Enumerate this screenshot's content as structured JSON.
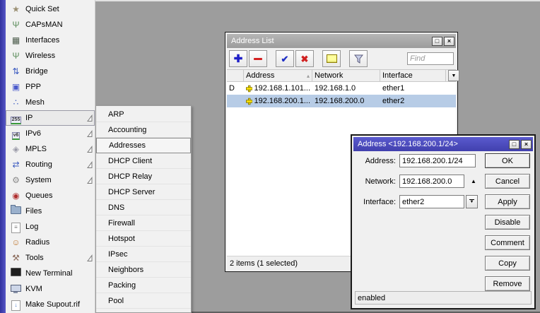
{
  "colors": {
    "accent_titlebar": "#4747bd",
    "inactive_titlebar": "#a8a8a8",
    "selected_row": "#b7cce6",
    "canvas": "#9d9d9d"
  },
  "icons": {
    "wand": "★",
    "antenna": "Ψ",
    "interfaces": "▦",
    "bridge": "⇅",
    "ppp": "▣",
    "mesh": "∴",
    "ip_chip": "255",
    "ipv6_chip": "v6",
    "mpls": "◈",
    "routing": "⇄",
    "system": "⚙",
    "queues": "◉",
    "log": "≡",
    "radius": "☺",
    "tools": "⚒",
    "supout": "↓",
    "plus": "✚",
    "check": "✔",
    "cross": "✖",
    "maximize": "□",
    "close": "×",
    "dropdown": "▼",
    "up_arrow": "▲",
    "sort_asc": "▴"
  },
  "sidebar": {
    "items": [
      {
        "label": "Quick Set"
      },
      {
        "label": "CAPsMAN"
      },
      {
        "label": "Interfaces"
      },
      {
        "label": "Wireless"
      },
      {
        "label": "Bridge"
      },
      {
        "label": "PPP"
      },
      {
        "label": "Mesh"
      },
      {
        "label": "IP",
        "selected": true,
        "has_submenu": true
      },
      {
        "label": "IPv6",
        "has_submenu": true
      },
      {
        "label": "MPLS",
        "has_submenu": true
      },
      {
        "label": "Routing",
        "has_submenu": true
      },
      {
        "label": "System",
        "has_submenu": true
      },
      {
        "label": "Queues"
      },
      {
        "label": "Files"
      },
      {
        "label": "Log"
      },
      {
        "label": "Radius"
      },
      {
        "label": "Tools",
        "has_submenu": true
      },
      {
        "label": "New Terminal"
      },
      {
        "label": "KVM"
      },
      {
        "label": "Make Supout.rif"
      }
    ]
  },
  "submenu": {
    "items": [
      {
        "label": "ARP"
      },
      {
        "label": "Accounting"
      },
      {
        "label": "Addresses",
        "selected": true
      },
      {
        "label": "DHCP Client"
      },
      {
        "label": "DHCP Relay"
      },
      {
        "label": "DHCP Server"
      },
      {
        "label": "DNS"
      },
      {
        "label": "Firewall"
      },
      {
        "label": "Hotspot"
      },
      {
        "label": "IPsec"
      },
      {
        "label": "Neighbors"
      },
      {
        "label": "Packing"
      },
      {
        "label": "Pool"
      }
    ]
  },
  "address_list": {
    "title": "Address List",
    "find_placeholder": "Find",
    "table": {
      "columns": [
        "Address",
        "Network",
        "Interface"
      ],
      "rows": [
        {
          "flag": "D",
          "address": "192.168.1.101...",
          "network": "192.168.1.0",
          "interface": "ether1",
          "selected": false
        },
        {
          "flag": "",
          "address": "192.168.200.1...",
          "network": "192.168.200.0",
          "interface": "ether2",
          "selected": true
        }
      ]
    },
    "status": "2 items (1 selected)"
  },
  "address_dialog": {
    "title": "Address <192.168.200.1/24>",
    "fields": [
      {
        "label": "Address:",
        "value": "192.168.200.1/24"
      },
      {
        "label": "Network:",
        "value": "192.168.200.0"
      },
      {
        "label": "Interface:",
        "value": "ether2"
      }
    ],
    "buttons": [
      {
        "label": "OK"
      },
      {
        "label": "Cancel"
      },
      {
        "label": "Apply"
      },
      {
        "label": "Disable"
      },
      {
        "label": "Comment"
      },
      {
        "label": "Copy"
      },
      {
        "label": "Remove"
      }
    ],
    "status": "enabled"
  }
}
